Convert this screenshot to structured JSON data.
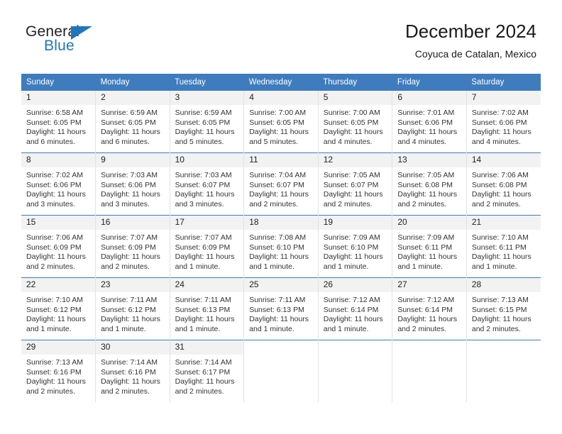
{
  "brand": {
    "name_part1": "General",
    "name_part2": "Blue",
    "triangle_color": "#1f76bc"
  },
  "header": {
    "title": "December 2024",
    "subtitle": "Coyuca de Catalan, Mexico"
  },
  "calendar": {
    "header_bg": "#3e7cbe",
    "daynum_bg": "#f2f2f2",
    "weekday_headers": [
      "Sunday",
      "Monday",
      "Tuesday",
      "Wednesday",
      "Thursday",
      "Friday",
      "Saturday"
    ],
    "weeks": [
      [
        {
          "day": "1",
          "sunrise": "Sunrise: 6:58 AM",
          "sunset": "Sunset: 6:05 PM",
          "daylight_line1": "Daylight: 11 hours",
          "daylight_line2": "and 6 minutes."
        },
        {
          "day": "2",
          "sunrise": "Sunrise: 6:59 AM",
          "sunset": "Sunset: 6:05 PM",
          "daylight_line1": "Daylight: 11 hours",
          "daylight_line2": "and 6 minutes."
        },
        {
          "day": "3",
          "sunrise": "Sunrise: 6:59 AM",
          "sunset": "Sunset: 6:05 PM",
          "daylight_line1": "Daylight: 11 hours",
          "daylight_line2": "and 5 minutes."
        },
        {
          "day": "4",
          "sunrise": "Sunrise: 7:00 AM",
          "sunset": "Sunset: 6:05 PM",
          "daylight_line1": "Daylight: 11 hours",
          "daylight_line2": "and 5 minutes."
        },
        {
          "day": "5",
          "sunrise": "Sunrise: 7:00 AM",
          "sunset": "Sunset: 6:05 PM",
          "daylight_line1": "Daylight: 11 hours",
          "daylight_line2": "and 4 minutes."
        },
        {
          "day": "6",
          "sunrise": "Sunrise: 7:01 AM",
          "sunset": "Sunset: 6:06 PM",
          "daylight_line1": "Daylight: 11 hours",
          "daylight_line2": "and 4 minutes."
        },
        {
          "day": "7",
          "sunrise": "Sunrise: 7:02 AM",
          "sunset": "Sunset: 6:06 PM",
          "daylight_line1": "Daylight: 11 hours",
          "daylight_line2": "and 4 minutes."
        }
      ],
      [
        {
          "day": "8",
          "sunrise": "Sunrise: 7:02 AM",
          "sunset": "Sunset: 6:06 PM",
          "daylight_line1": "Daylight: 11 hours",
          "daylight_line2": "and 3 minutes."
        },
        {
          "day": "9",
          "sunrise": "Sunrise: 7:03 AM",
          "sunset": "Sunset: 6:06 PM",
          "daylight_line1": "Daylight: 11 hours",
          "daylight_line2": "and 3 minutes."
        },
        {
          "day": "10",
          "sunrise": "Sunrise: 7:03 AM",
          "sunset": "Sunset: 6:07 PM",
          "daylight_line1": "Daylight: 11 hours",
          "daylight_line2": "and 3 minutes."
        },
        {
          "day": "11",
          "sunrise": "Sunrise: 7:04 AM",
          "sunset": "Sunset: 6:07 PM",
          "daylight_line1": "Daylight: 11 hours",
          "daylight_line2": "and 2 minutes."
        },
        {
          "day": "12",
          "sunrise": "Sunrise: 7:05 AM",
          "sunset": "Sunset: 6:07 PM",
          "daylight_line1": "Daylight: 11 hours",
          "daylight_line2": "and 2 minutes."
        },
        {
          "day": "13",
          "sunrise": "Sunrise: 7:05 AM",
          "sunset": "Sunset: 6:08 PM",
          "daylight_line1": "Daylight: 11 hours",
          "daylight_line2": "and 2 minutes."
        },
        {
          "day": "14",
          "sunrise": "Sunrise: 7:06 AM",
          "sunset": "Sunset: 6:08 PM",
          "daylight_line1": "Daylight: 11 hours",
          "daylight_line2": "and 2 minutes."
        }
      ],
      [
        {
          "day": "15",
          "sunrise": "Sunrise: 7:06 AM",
          "sunset": "Sunset: 6:09 PM",
          "daylight_line1": "Daylight: 11 hours",
          "daylight_line2": "and 2 minutes."
        },
        {
          "day": "16",
          "sunrise": "Sunrise: 7:07 AM",
          "sunset": "Sunset: 6:09 PM",
          "daylight_line1": "Daylight: 11 hours",
          "daylight_line2": "and 2 minutes."
        },
        {
          "day": "17",
          "sunrise": "Sunrise: 7:07 AM",
          "sunset": "Sunset: 6:09 PM",
          "daylight_line1": "Daylight: 11 hours",
          "daylight_line2": "and 1 minute."
        },
        {
          "day": "18",
          "sunrise": "Sunrise: 7:08 AM",
          "sunset": "Sunset: 6:10 PM",
          "daylight_line1": "Daylight: 11 hours",
          "daylight_line2": "and 1 minute."
        },
        {
          "day": "19",
          "sunrise": "Sunrise: 7:09 AM",
          "sunset": "Sunset: 6:10 PM",
          "daylight_line1": "Daylight: 11 hours",
          "daylight_line2": "and 1 minute."
        },
        {
          "day": "20",
          "sunrise": "Sunrise: 7:09 AM",
          "sunset": "Sunset: 6:11 PM",
          "daylight_line1": "Daylight: 11 hours",
          "daylight_line2": "and 1 minute."
        },
        {
          "day": "21",
          "sunrise": "Sunrise: 7:10 AM",
          "sunset": "Sunset: 6:11 PM",
          "daylight_line1": "Daylight: 11 hours",
          "daylight_line2": "and 1 minute."
        }
      ],
      [
        {
          "day": "22",
          "sunrise": "Sunrise: 7:10 AM",
          "sunset": "Sunset: 6:12 PM",
          "daylight_line1": "Daylight: 11 hours",
          "daylight_line2": "and 1 minute."
        },
        {
          "day": "23",
          "sunrise": "Sunrise: 7:11 AM",
          "sunset": "Sunset: 6:12 PM",
          "daylight_line1": "Daylight: 11 hours",
          "daylight_line2": "and 1 minute."
        },
        {
          "day": "24",
          "sunrise": "Sunrise: 7:11 AM",
          "sunset": "Sunset: 6:13 PM",
          "daylight_line1": "Daylight: 11 hours",
          "daylight_line2": "and 1 minute."
        },
        {
          "day": "25",
          "sunrise": "Sunrise: 7:11 AM",
          "sunset": "Sunset: 6:13 PM",
          "daylight_line1": "Daylight: 11 hours",
          "daylight_line2": "and 1 minute."
        },
        {
          "day": "26",
          "sunrise": "Sunrise: 7:12 AM",
          "sunset": "Sunset: 6:14 PM",
          "daylight_line1": "Daylight: 11 hours",
          "daylight_line2": "and 1 minute."
        },
        {
          "day": "27",
          "sunrise": "Sunrise: 7:12 AM",
          "sunset": "Sunset: 6:14 PM",
          "daylight_line1": "Daylight: 11 hours",
          "daylight_line2": "and 2 minutes."
        },
        {
          "day": "28",
          "sunrise": "Sunrise: 7:13 AM",
          "sunset": "Sunset: 6:15 PM",
          "daylight_line1": "Daylight: 11 hours",
          "daylight_line2": "and 2 minutes."
        }
      ],
      [
        {
          "day": "29",
          "sunrise": "Sunrise: 7:13 AM",
          "sunset": "Sunset: 6:16 PM",
          "daylight_line1": "Daylight: 11 hours",
          "daylight_line2": "and 2 minutes."
        },
        {
          "day": "30",
          "sunrise": "Sunrise: 7:14 AM",
          "sunset": "Sunset: 6:16 PM",
          "daylight_line1": "Daylight: 11 hours",
          "daylight_line2": "and 2 minutes."
        },
        {
          "day": "31",
          "sunrise": "Sunrise: 7:14 AM",
          "sunset": "Sunset: 6:17 PM",
          "daylight_line1": "Daylight: 11 hours",
          "daylight_line2": "and 2 minutes."
        },
        {
          "day": "",
          "sunrise": "",
          "sunset": "",
          "daylight_line1": "",
          "daylight_line2": ""
        },
        {
          "day": "",
          "sunrise": "",
          "sunset": "",
          "daylight_line1": "",
          "daylight_line2": ""
        },
        {
          "day": "",
          "sunrise": "",
          "sunset": "",
          "daylight_line1": "",
          "daylight_line2": ""
        },
        {
          "day": "",
          "sunrise": "",
          "sunset": "",
          "daylight_line1": "",
          "daylight_line2": ""
        }
      ]
    ]
  }
}
